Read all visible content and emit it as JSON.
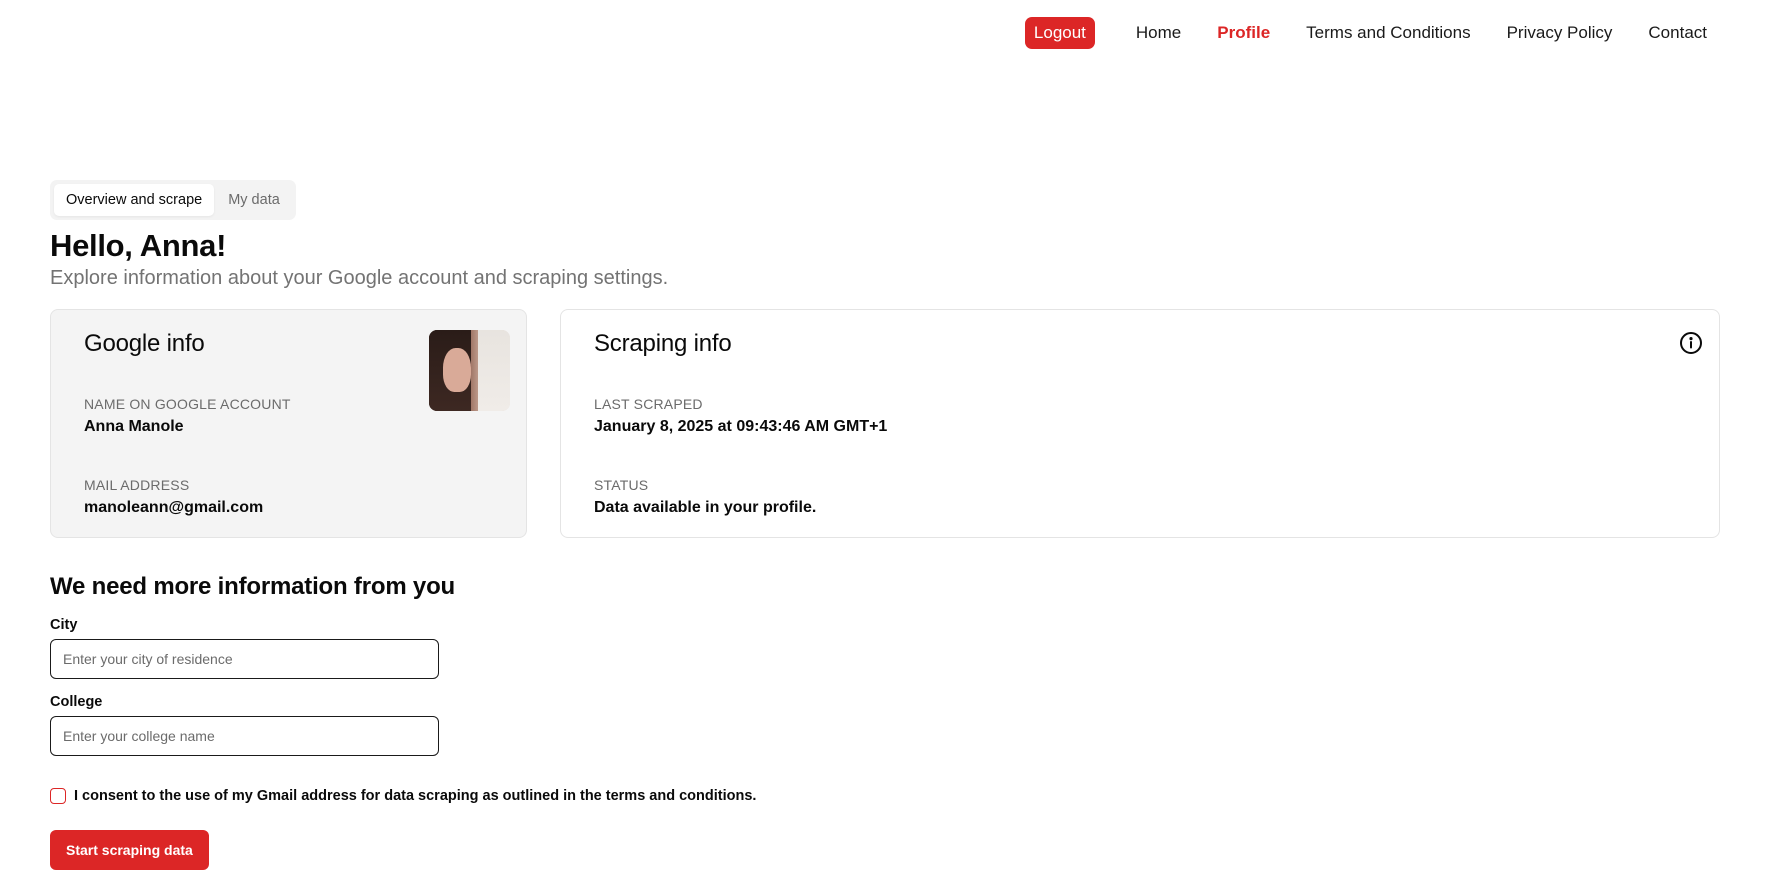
{
  "nav": {
    "logout_label": "Logout",
    "links": [
      {
        "label": "Home",
        "active": false
      },
      {
        "label": "Profile",
        "active": true
      },
      {
        "label": "Terms and Conditions",
        "active": false
      },
      {
        "label": "Privacy Policy",
        "active": false
      },
      {
        "label": "Contact",
        "active": false
      }
    ]
  },
  "tabs": [
    {
      "label": "Overview and scrape",
      "active": true
    },
    {
      "label": "My data",
      "active": false
    }
  ],
  "header": {
    "greeting": "Hello, Anna!",
    "subtitle": "Explore information about your Google account and scraping settings."
  },
  "google_info": {
    "title": "Google info",
    "name_label": "NAME ON GOOGLE ACCOUNT",
    "name_value": "Anna Manole",
    "mail_label": "MAIL ADDRESS",
    "mail_value": "manoleann@gmail.com"
  },
  "scraping_info": {
    "title": "Scraping info",
    "last_scraped_label": "LAST SCRAPED",
    "last_scraped_value": "January 8, 2025 at 09:43:46 AM GMT+1",
    "status_label": "STATUS",
    "status_value": "Data available in your profile."
  },
  "form": {
    "title": "We need more information from you",
    "city_label": "City",
    "city_placeholder": "Enter your city of residence",
    "college_label": "College",
    "college_placeholder": "Enter your college name",
    "consent_text": "I consent to the use of my Gmail address for data scraping as outlined in the terms and conditions.",
    "submit_label": "Start scraping data"
  },
  "colors": {
    "accent": "#dc2626",
    "card_gray": "#f4f4f4",
    "muted_text": "#737373"
  },
  "icons": {
    "info": "info-circle-icon",
    "avatar": "profile-photo"
  }
}
